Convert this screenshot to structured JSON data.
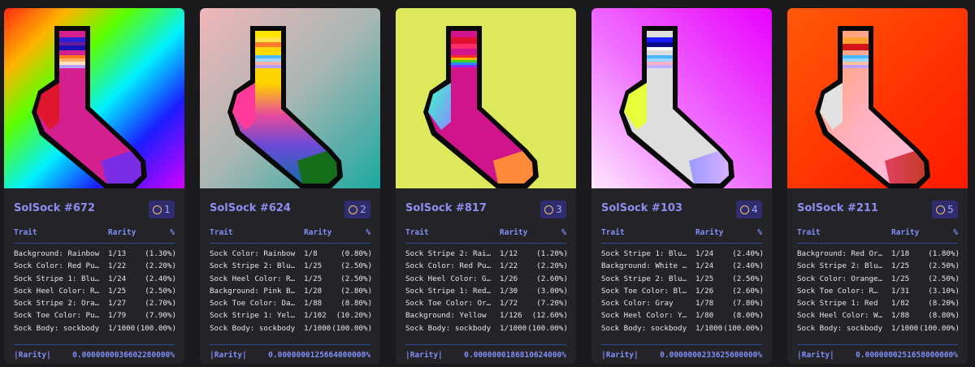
{
  "table_headers": {
    "trait": "Trait",
    "rarity": "Rarity",
    "percent": "%"
  },
  "footer_label": "|Rarity|",
  "cards": [
    {
      "title": "SolSock #672",
      "rank": "1",
      "rows": [
        {
          "trait": "Background: Rainbow",
          "rarity": "1/13",
          "percent": "(1.30%)"
        },
        {
          "trait": "Sock Color: Red Pu…",
          "rarity": "1/22",
          "percent": "(2.20%)"
        },
        {
          "trait": "Sock Stripe 1: Blu…",
          "rarity": "1/24",
          "percent": "(2.40%)"
        },
        {
          "trait": "Sock Heel Color: R…",
          "rarity": "1/25",
          "percent": "(2.50%)"
        },
        {
          "trait": "Sock Stripe 2: Ora…",
          "rarity": "1/27",
          "percent": "(2.70%)"
        },
        {
          "trait": "Sock Toe Color: Pu…",
          "rarity": "1/79",
          "percent": "(7.90%)"
        },
        {
          "trait": "Sock Body: sockbody",
          "rarity": "1/1000",
          "percent": "(100.00%)"
        }
      ],
      "total": "0.0000000036602280000%"
    },
    {
      "title": "SolSock #624",
      "rank": "2",
      "rows": [
        {
          "trait": "Sock Color: Rainbow",
          "rarity": "1/8",
          "percent": "(0.80%)"
        },
        {
          "trait": "Sock Stripe 2: Blu…",
          "rarity": "1/25",
          "percent": "(2.50%)"
        },
        {
          "trait": "Sock Heel Color: R…",
          "rarity": "1/25",
          "percent": "(2.50%)"
        },
        {
          "trait": "Background: Pink B…",
          "rarity": "1/28",
          "percent": "(2.80%)"
        },
        {
          "trait": "Sock Toe Color: Da…",
          "rarity": "1/88",
          "percent": "(8.80%)"
        },
        {
          "trait": "Sock Stripe 1: Yel…",
          "rarity": "1/102",
          "percent": "(10.20%)"
        },
        {
          "trait": "Sock Body: sockbody",
          "rarity": "1/1000",
          "percent": "(100.00%)"
        }
      ],
      "total": "0.0000000125664000000%"
    },
    {
      "title": "SolSock #817",
      "rank": "3",
      "rows": [
        {
          "trait": "Sock Stripe 2: Rai…",
          "rarity": "1/12",
          "percent": "(1.20%)"
        },
        {
          "trait": "Sock Color: Red Pu…",
          "rarity": "1/22",
          "percent": "(2.20%)"
        },
        {
          "trait": "Sock Heel Color: G…",
          "rarity": "1/26",
          "percent": "(2.60%)"
        },
        {
          "trait": "Sock Stripe 1: Red…",
          "rarity": "1/30",
          "percent": "(3.00%)"
        },
        {
          "trait": "Sock Toe Color: Or…",
          "rarity": "1/72",
          "percent": "(7.20%)"
        },
        {
          "trait": "Background: Yellow",
          "rarity": "1/126",
          "percent": "(12.60%)"
        },
        {
          "trait": "Sock Body: sockbody",
          "rarity": "1/1000",
          "percent": "(100.00%)"
        }
      ],
      "total": "0.0000000186810624000%"
    },
    {
      "title": "SolSock #103",
      "rank": "4",
      "rows": [
        {
          "trait": "Sock Stripe 1: Blu…",
          "rarity": "1/24",
          "percent": "(2.40%)"
        },
        {
          "trait": "Background: White …",
          "rarity": "1/24",
          "percent": "(2.40%)"
        },
        {
          "trait": "Sock Stripe 2: Blu…",
          "rarity": "1/25",
          "percent": "(2.50%)"
        },
        {
          "trait": "Sock Toe Color: Bl…",
          "rarity": "1/26",
          "percent": "(2.60%)"
        },
        {
          "trait": "Sock Color: Gray",
          "rarity": "1/78",
          "percent": "(7.80%)"
        },
        {
          "trait": "Sock Heel Color: Y…",
          "rarity": "1/80",
          "percent": "(8.00%)"
        },
        {
          "trait": "Sock Body: sockbody",
          "rarity": "1/1000",
          "percent": "(100.00%)"
        }
      ],
      "total": "0.0000000233625600000%"
    },
    {
      "title": "SolSock #211",
      "rank": "5",
      "rows": [
        {
          "trait": "Background: Red Or…",
          "rarity": "1/18",
          "percent": "(1.80%)"
        },
        {
          "trait": "Sock Stripe 2: Blu…",
          "rarity": "1/25",
          "percent": "(2.50%)"
        },
        {
          "trait": "Sock Color: Orange…",
          "rarity": "1/25",
          "percent": "(2.50%)"
        },
        {
          "trait": "Sock Toe Color: R…",
          "rarity": "1/31",
          "percent": "(3.10%)"
        },
        {
          "trait": "Sock Stripe 1: Red",
          "rarity": "1/82",
          "percent": "(8.20%)"
        },
        {
          "trait": "Sock Heel Color: W…",
          "rarity": "1/88",
          "percent": "(8.80%)"
        },
        {
          "trait": "Sock Body: sockbody",
          "rarity": "1/1000",
          "percent": "(100.00%)"
        }
      ],
      "total": "0.0000000251658000000%"
    }
  ]
}
